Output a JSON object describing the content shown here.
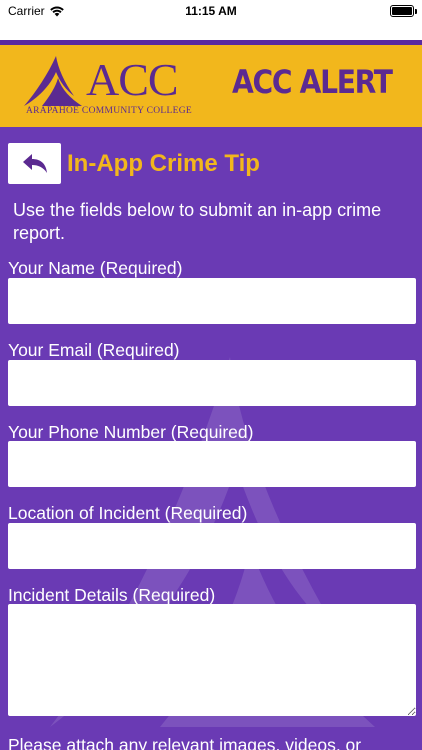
{
  "status_bar": {
    "carrier": "Carrier",
    "time": "11:15 AM"
  },
  "banner": {
    "logo_text": "ACC",
    "logo_subtitle": "ARAPAHOE COMMUNITY COLLEGE",
    "alert_title": "ACC ALERT"
  },
  "page": {
    "title": "In-App Crime Tip",
    "intro": "Use the fields below to submit an in-app crime report."
  },
  "form": {
    "name_label": "Your Name (Required)",
    "name_value": "",
    "email_label": "Your Email (Required)",
    "email_value": "",
    "phone_label": "Your Phone Number (Required)",
    "phone_value": "",
    "location_label": "Location of Incident (Required)",
    "location_value": "",
    "details_label": "Incident Details (Required)",
    "details_value": "",
    "attach_text": "Please attach any relevant images, videos, or"
  },
  "icons": {
    "back": "back-arrow-icon",
    "wifi": "wifi-icon",
    "battery": "battery-icon"
  },
  "colors": {
    "background": "#6a3ab4",
    "banner": "#f2b71c",
    "brand_purple": "#5b2a91",
    "title_gold": "#f2b71c"
  }
}
